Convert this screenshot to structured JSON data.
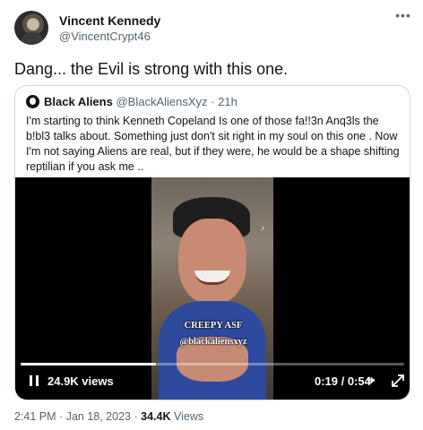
{
  "author": {
    "name": "Vincent Kennedy",
    "handle": "@VincentCrypt46"
  },
  "more_icon": "more-horizontal-icon",
  "tweet_text": "Dang... the Evil is strong with this one.",
  "quote": {
    "name": "Black Aliens",
    "handle": "@BlackAliensXyz",
    "separator": "·",
    "time": "21h",
    "text": "I'm starting to think Kenneth Copeland Is one of those fa!!3n Anq3ls the b!bl3 talks about. Something just don't sit right in my soul on this one . Now I'm not saying Aliens are real, but if they were, he would be a shape shifting reptilian if you ask me ..",
    "video": {
      "overlay_lines": [
        "CREEPY ASF",
        "@blackaliensxyz"
      ],
      "views": "24.9K views",
      "time": "0:19 / 0:54",
      "progress": 0.352,
      "icons": [
        "pause-icon",
        "volume-icon",
        "expand-icon"
      ]
    }
  },
  "meta": {
    "time": "2:41 PM",
    "separator": "·",
    "date": "Jan 18, 2023",
    "separator2": "·",
    "views_count": "34.4K",
    "views_label": "Views"
  },
  "colors": {
    "text": "#0f1419",
    "secondary": "#536471",
    "border": "#cfd9de"
  }
}
